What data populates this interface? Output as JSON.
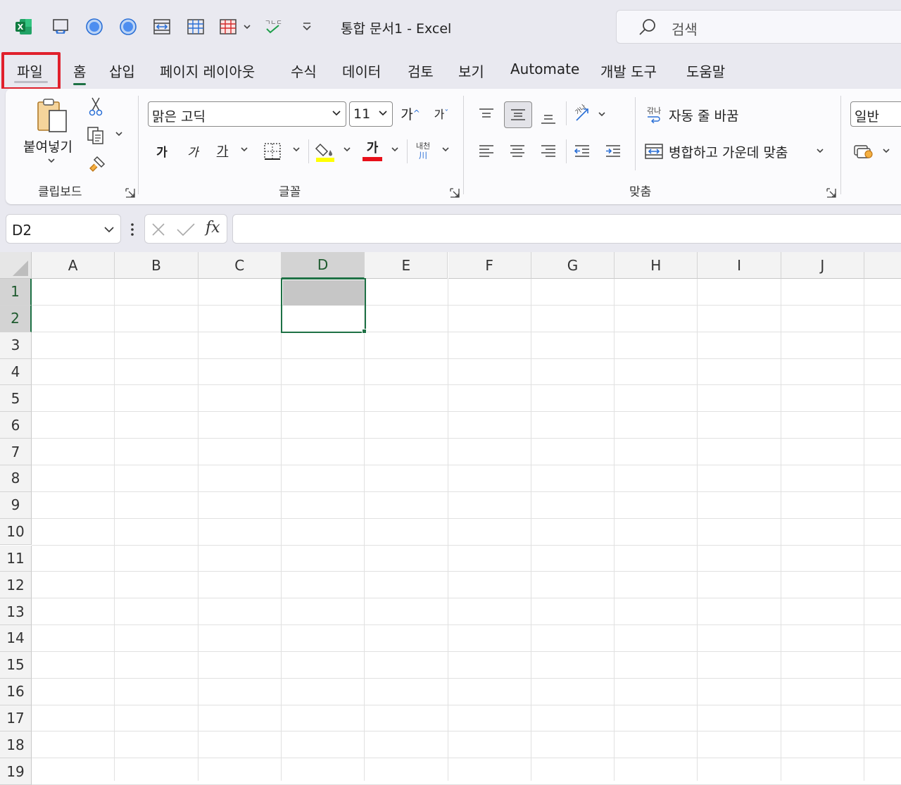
{
  "app": {
    "title": "통합 문서1  -  Excel"
  },
  "search": {
    "placeholder": "검색"
  },
  "tabs": [
    {
      "label": "파일"
    },
    {
      "label": "홈"
    },
    {
      "label": "삽입"
    },
    {
      "label": "페이지 레이아웃"
    },
    {
      "label": "수식"
    },
    {
      "label": "데이터"
    },
    {
      "label": "검토"
    },
    {
      "label": "보기"
    },
    {
      "label": "Automate"
    },
    {
      "label": "개발 도구"
    },
    {
      "label": "도움말"
    }
  ],
  "active_tab": "홈",
  "highlighted_tab": "파일",
  "ribbon": {
    "clipboard": {
      "paste_label": "붙여넣기",
      "group_label": "클립보드"
    },
    "font": {
      "name": "맑은 고딕",
      "size": "11",
      "grow_label": "가",
      "shrink_label": "가",
      "bold_label": "가",
      "italic_label": "가",
      "underline_label": "가",
      "font_color_label": "가",
      "phonetic_label": "내천",
      "group_label": "글꼴",
      "highlight_color": "#ffff00",
      "font_color": "#e8101a"
    },
    "alignment": {
      "wrap_label": "자동 줄 바꿈",
      "wrap_icon_text": "갂나",
      "merge_label": "병합하고 가운데 맞춤",
      "group_label": "맞춤"
    },
    "number": {
      "format": "일반"
    }
  },
  "formula_bar": {
    "name_box": "D2",
    "formula": "",
    "fx_label": "fx"
  },
  "sheet": {
    "columns": [
      "A",
      "B",
      "C",
      "D",
      "E",
      "F",
      "G",
      "H",
      "I",
      "J"
    ],
    "rows": [
      "1",
      "2",
      "3",
      "4",
      "5",
      "6",
      "7",
      "8",
      "9",
      "10",
      "11",
      "12",
      "13",
      "14",
      "15",
      "16",
      "17",
      "18",
      "19"
    ],
    "selected_column": "D",
    "selected_rows": [
      "1",
      "2"
    ],
    "active_cell": "D2",
    "filled_cell": "D1",
    "filled_color": "#c6c6c6",
    "accent": "#1e7145"
  }
}
